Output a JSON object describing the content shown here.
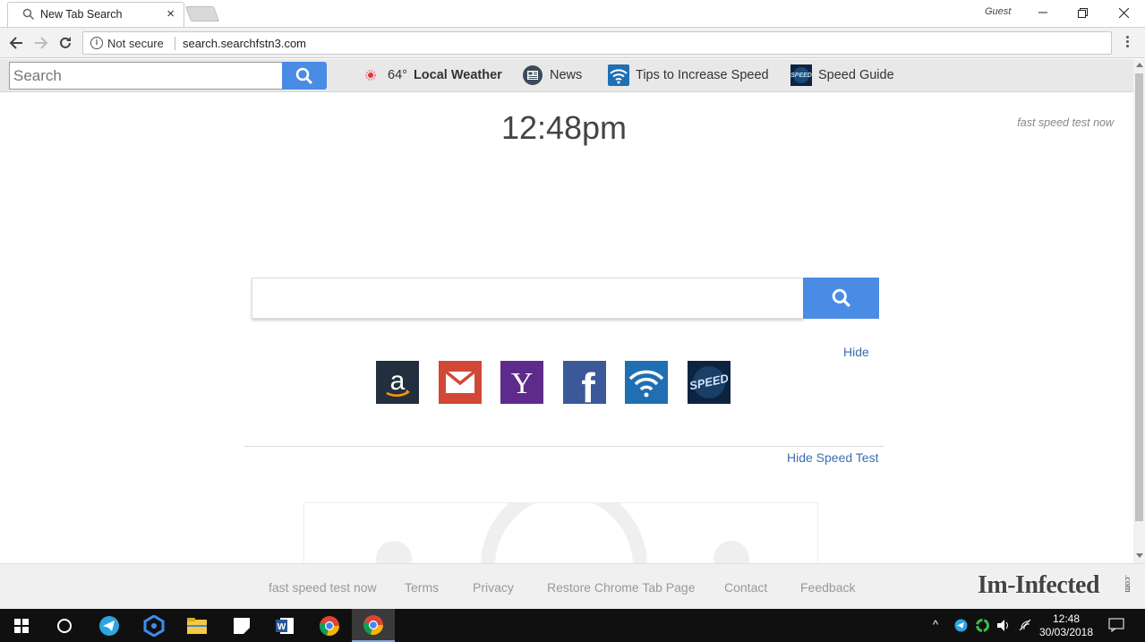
{
  "browser": {
    "tab_title": "New Tab Search",
    "tab_close": "×",
    "profile": "Guest",
    "security_label": "Not secure",
    "url": "search.searchfstn3.com"
  },
  "toolbar": {
    "search_placeholder": "Search",
    "weather_temp": "64°",
    "weather_label": "Local Weather",
    "news_label": "News",
    "tips_label": "Tips to Increase Speed",
    "speed_guide_label": "Speed Guide"
  },
  "main": {
    "clock": "12:48pm",
    "fast_speed_link": "fast speed test now",
    "hide_label": "Hide",
    "hide_speed_test": "Hide Speed Test",
    "shortcuts": [
      "amazon-icon",
      "gmail-icon",
      "yahoo-icon",
      "facebook-icon",
      "wifi-speed-icon",
      "speed-icon"
    ],
    "shortcut_colors": {
      "amazon": "#232f3e",
      "gmail": "#d14836",
      "yahoo": "#5f2b8a",
      "facebook": "#3b5998",
      "wifi": "#1f6fb2",
      "speed": "#0d2440"
    },
    "speed_text": "SPEED"
  },
  "footer": {
    "links": [
      "fast speed test now",
      "Terms",
      "Privacy",
      "Restore Chrome Tab Page",
      "Contact",
      "Feedback"
    ],
    "brand": "Im-Infected",
    "brand_suffix": ".com"
  },
  "taskbar": {
    "time": "12:48",
    "date": "30/03/2018"
  },
  "colors": {
    "accent_blue": "#4a8be5",
    "link_blue": "#3b6eb1"
  }
}
